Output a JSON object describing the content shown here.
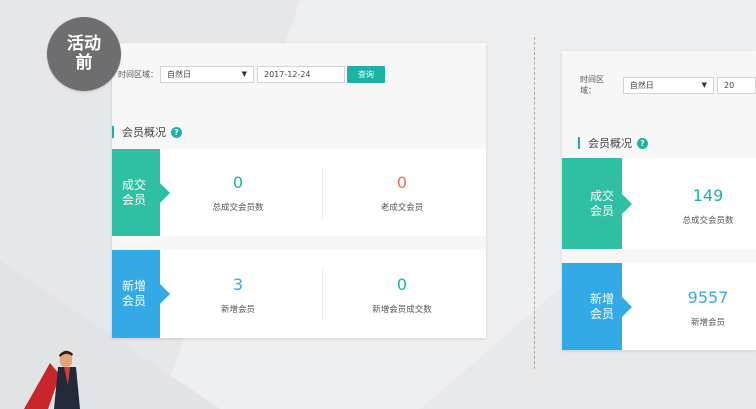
{
  "badge": {
    "line1": "活动",
    "line2": "前"
  },
  "left": {
    "filter": {
      "label": "时间区域：",
      "select_value": "自然日",
      "date_value": "2017-12-24",
      "query_label": "查询"
    },
    "section_title": "会员概况",
    "deal": {
      "tag_line1": "成交",
      "tag_line2": "会员",
      "stats": [
        {
          "value": "0",
          "label": "总成交会员数"
        },
        {
          "value": "0",
          "label": "老成交会员"
        }
      ]
    },
    "new": {
      "tag_line1": "新增",
      "tag_line2": "会员",
      "stats": [
        {
          "value": "3",
          "label": "新增会员"
        },
        {
          "value": "0",
          "label": "新增会员成交数"
        }
      ]
    }
  },
  "right": {
    "filter": {
      "label": "时间区域：",
      "select_value": "自然日",
      "date_value": "20"
    },
    "section_title": "会员概况",
    "deal": {
      "tag_line1": "成交",
      "tag_line2": "会员",
      "stats": [
        {
          "value": "149",
          "label": "总成交会员数"
        }
      ]
    },
    "new": {
      "tag_line1": "新增",
      "tag_line2": "会员",
      "stats": [
        {
          "value": "9557",
          "label": "新增会员"
        }
      ]
    }
  },
  "colors": {
    "teal": "#1ab3a6",
    "green_tag": "#2fbfa2",
    "blue_tag": "#33a9e6",
    "red_value": "#f06e5e"
  },
  "icons": {
    "help": "help-circle-icon",
    "dropdown": "caret-down-icon"
  }
}
